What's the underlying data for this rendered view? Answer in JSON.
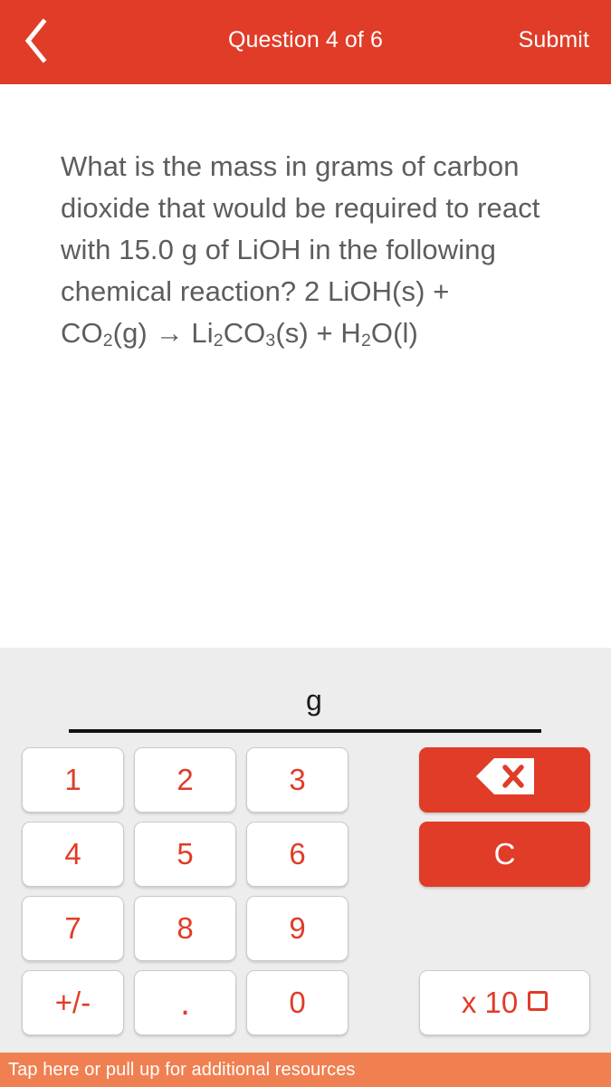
{
  "header": {
    "back_icon": "chevron-left-icon",
    "title": "Question 4 of 6",
    "submit_label": "Submit",
    "background_color": "#e03c28",
    "text_color": "#ffffff"
  },
  "question": {
    "text_before": "What is the mass in grams of carbon dioxide that would be required to react with 15.0 g of LiOH in the following chemical reaction? 2 LiOH(s) + CO",
    "sub1": "2",
    "mid1": "(g) → Li",
    "sub2": "2",
    "mid2": "CO",
    "sub3": "3",
    "mid3": "(s) + H",
    "sub4": "2",
    "mid4": "O(l)",
    "text_color": "#5d5d5d"
  },
  "answer": {
    "value": "",
    "unit": "g",
    "underline_color": "#111111"
  },
  "keypad": {
    "background_color": "#ededed",
    "key_text_color": "#e03c28",
    "accent_color": "#e03c28",
    "keys": [
      {
        "name": "key-1",
        "label": "1",
        "style": "num"
      },
      {
        "name": "key-2",
        "label": "2",
        "style": "num"
      },
      {
        "name": "key-3",
        "label": "3",
        "style": "num"
      },
      {
        "name": "key-4",
        "label": "4",
        "style": "num"
      },
      {
        "name": "key-5",
        "label": "5",
        "style": "num"
      },
      {
        "name": "key-6",
        "label": "6",
        "style": "num"
      },
      {
        "name": "key-7",
        "label": "7",
        "style": "num"
      },
      {
        "name": "key-8",
        "label": "8",
        "style": "num"
      },
      {
        "name": "key-9",
        "label": "9",
        "style": "num"
      },
      {
        "name": "key-plus-minus",
        "label": "+/-",
        "style": "num"
      },
      {
        "name": "key-decimal",
        "label": ".",
        "style": "num"
      },
      {
        "name": "key-0",
        "label": "0",
        "style": "num"
      }
    ],
    "backspace_icon": "backspace-delete-icon",
    "clear_label": "C",
    "exponent_label": "x 10"
  },
  "footer": {
    "text": "Tap here or pull up for additional resources",
    "background_color": "#f08051",
    "text_color": "#ffffff"
  }
}
